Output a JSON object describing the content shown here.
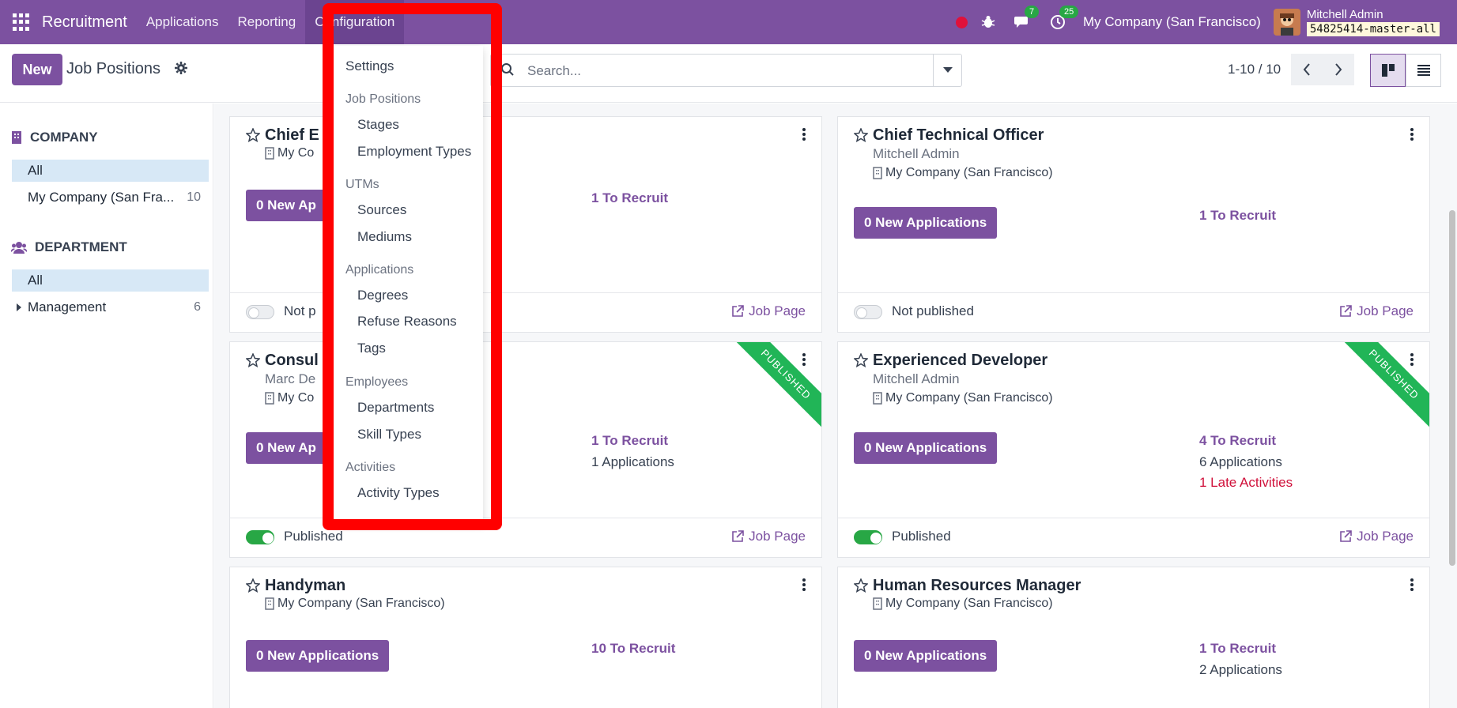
{
  "navbar": {
    "app_name": "Recruitment",
    "menu": [
      "Applications",
      "Reporting",
      "Configuration"
    ],
    "messages_count": "7",
    "activities_count": "25",
    "company": "My Company (San Francisco)",
    "user_name": "Mitchell Admin",
    "database": "54825414-master-all"
  },
  "control": {
    "new_label": "New",
    "title": "Job Positions",
    "search_placeholder": "Search...",
    "pager": "1-10 / 10"
  },
  "sidebar": {
    "company_heading": "COMPANY",
    "company_items": [
      {
        "label": "All",
        "count": ""
      },
      {
        "label": "My Company (San Fra...",
        "count": "10"
      }
    ],
    "department_heading": "DEPARTMENT",
    "department_items": [
      {
        "label": "All",
        "count": ""
      },
      {
        "label": "Management",
        "count": "6"
      }
    ]
  },
  "config_menu": {
    "settings": "Settings",
    "job_positions": "Job Positions",
    "stages": "Stages",
    "employment_types": "Employment Types",
    "utms": "UTMs",
    "sources": "Sources",
    "mediums": "Mediums",
    "applications": "Applications",
    "degrees": "Degrees",
    "refuse_reasons": "Refuse Reasons",
    "tags": "Tags",
    "employees": "Employees",
    "departments": "Departments",
    "skill_types": "Skill Types",
    "activities": "Activities",
    "activity_types": "Activity Types"
  },
  "cards": [
    {
      "title": "Chief E",
      "company": "My Co",
      "apps_btn": "0 New Ap",
      "to_recruit": "1 To Recruit",
      "published_label": "Not p",
      "job_page": "Job Page"
    },
    {
      "title": "Chief Technical Officer",
      "manager": "Mitchell Admin",
      "company": "My Company (San Francisco)",
      "apps_btn": "0 New Applications",
      "to_recruit": "1 To Recruit",
      "published_label": "Not published",
      "job_page": "Job Page"
    },
    {
      "title": "Consul",
      "manager": "Marc De",
      "company": "My Co",
      "apps_btn": "0 New Ap",
      "to_recruit": "1 To Recruit",
      "applications": "1 Applications",
      "published_label": "Published",
      "job_page": "Job Page",
      "ribbon": "PUBLISHED"
    },
    {
      "title": "Experienced Developer",
      "manager": "Mitchell Admin",
      "company": "My Company (San Francisco)",
      "apps_btn": "0 New Applications",
      "to_recruit": "4 To Recruit",
      "applications": "6 Applications",
      "late": "1 Late Activities",
      "published_label": "Published",
      "job_page": "Job Page",
      "ribbon": "PUBLISHED"
    },
    {
      "title": "Handyman",
      "company": "My Company (San Francisco)",
      "apps_btn": "0 New Applications",
      "to_recruit": "10 To Recruit"
    },
    {
      "title": "Human Resources Manager",
      "company": "My Company (San Francisco)",
      "apps_btn": "0 New Applications",
      "to_recruit": "1 To Recruit",
      "applications": "2 Applications"
    }
  ],
  "colors": {
    "brand": "#7c51a0",
    "published": "#21b557",
    "late": "#d0103a",
    "highlight": "#ff0000"
  }
}
